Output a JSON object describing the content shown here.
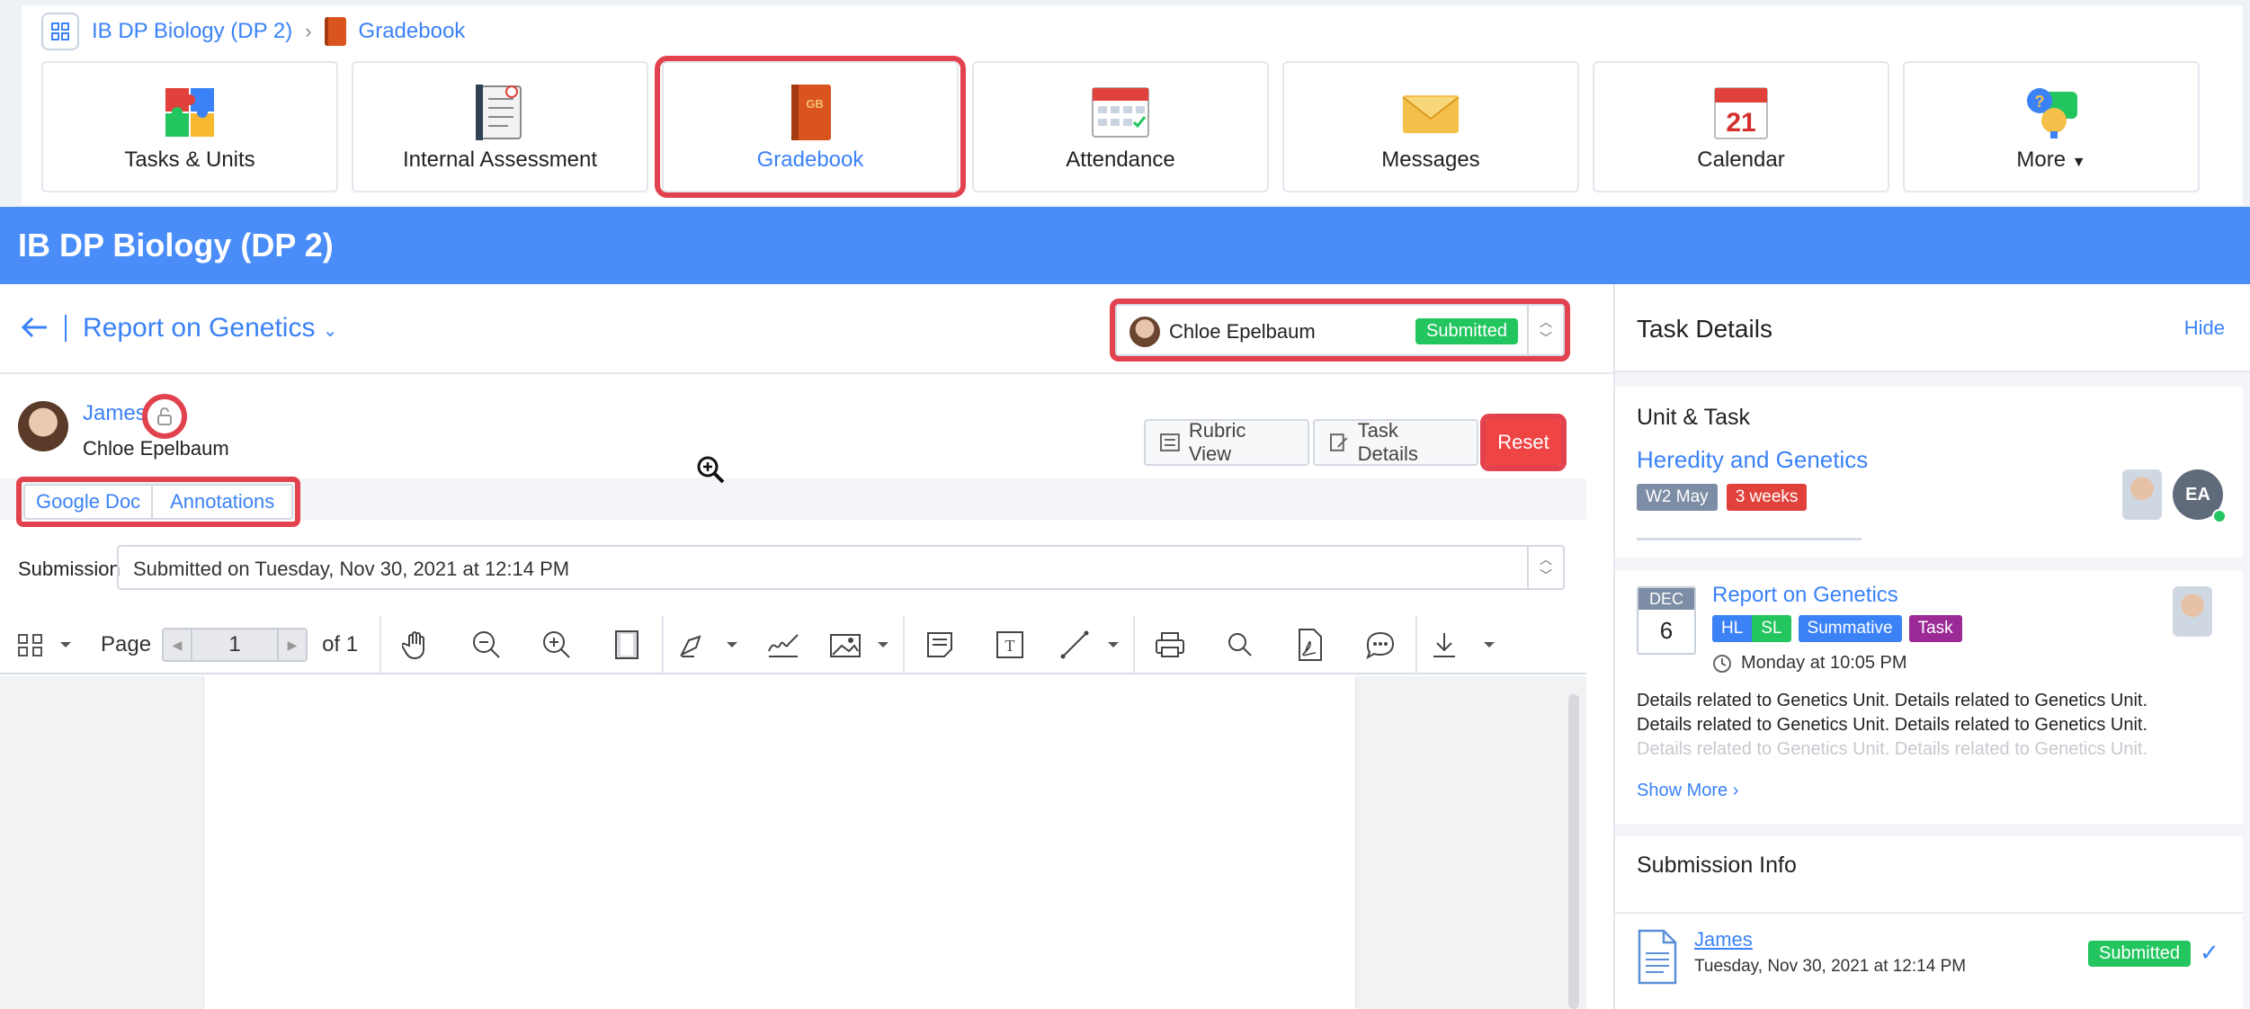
{
  "breadcrumb": {
    "course": "IB DP Biology (DP 2)",
    "page": "Gradebook"
  },
  "tiles": [
    {
      "label": "Tasks & Units",
      "icon": "puzzle-icon"
    },
    {
      "label": "Internal Assessment",
      "icon": "clipboard-icon"
    },
    {
      "label": "Gradebook",
      "icon": "gradebook-icon",
      "active": true
    },
    {
      "label": "Attendance",
      "icon": "attendance-icon"
    },
    {
      "label": "Messages",
      "icon": "envelope-icon"
    },
    {
      "label": "Calendar",
      "icon": "calendar-icon",
      "calendar_day": "21",
      "attendance_caption": "Attendance"
    },
    {
      "label": "More",
      "icon": "more-icon"
    }
  ],
  "course_title": "IB DP Biology (DP 2)",
  "task": {
    "title": "Report on Genetics"
  },
  "student_picker": {
    "name": "Chloe Epelbaum",
    "status": "Submitted"
  },
  "student": {
    "link": "James",
    "full_name": "Chloe Epelbaum"
  },
  "buttons": {
    "rubric": "Rubric View",
    "task_details": "Task Details",
    "reset": "Reset"
  },
  "tabs": [
    "Google Doc",
    "Annotations"
  ],
  "submission": {
    "label": "Submission",
    "value": "Submitted on Tuesday, Nov 30, 2021 at 12:14 PM"
  },
  "toolbar": {
    "page_label": "Page",
    "page_num": "1",
    "of_label": "of 1"
  },
  "right_panel": {
    "title": "Task Details",
    "hide": "Hide",
    "unit_heading": "Unit & Task",
    "unit_link": "Heredity and Genetics",
    "unit_tags": [
      "W2 May",
      "3 weeks"
    ],
    "ea_initials": "EA",
    "task": {
      "month": "DEC",
      "day": "6",
      "link": "Report on Genetics",
      "tags": [
        "HL",
        "SL",
        "Summative",
        "Task"
      ],
      "due": "Monday at 10:05 PM",
      "desc_1": "Details related to Genetics Unit. Details related to Genetics Unit.",
      "desc_2": "Details related to Genetics Unit. Details related to Genetics Unit.",
      "desc_3": "Details related to Genetics Unit. Details related to Genetics Unit.",
      "show_more": "Show More"
    },
    "submission_info": {
      "title": "Submission Info",
      "name": "James",
      "date": "Tuesday, Nov 30, 2021 at 12:14 PM",
      "status": "Submitted"
    }
  },
  "colors": {
    "accent": "#3b82f6",
    "course_bar": "#4a8df8",
    "submitted": "#22c55e",
    "reset": "#ef4444",
    "highlight": "#e2424e",
    "tag_gray": "#7c8da5",
    "tag_red": "#e0413a",
    "tag_purple": "#9b2a96"
  }
}
